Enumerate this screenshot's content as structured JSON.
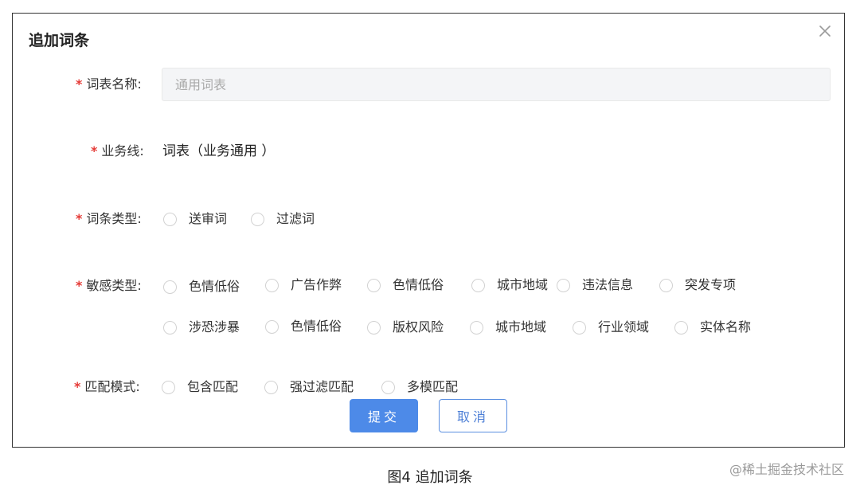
{
  "dialog": {
    "title": "追加词条",
    "close_icon": "close-x-icon"
  },
  "form": {
    "table_name": {
      "required_mark": "*",
      "label": "词表名称:",
      "placeholder": "通用词表",
      "value": ""
    },
    "business_line": {
      "required_mark": "*",
      "label": "业务线:",
      "value": "词表（业务通用 ）"
    },
    "entry_type": {
      "required_mark": "*",
      "label": "词条类型:",
      "options": [
        "送审词",
        "过滤词"
      ]
    },
    "sensitive_type": {
      "required_mark": "*",
      "label": "敏感类型:",
      "options": [
        "色情低俗",
        "广告作弊",
        "色情低俗",
        "城市地域",
        "违法信息",
        "突发专项",
        "涉恐涉暴",
        "色情低俗",
        "版权风险",
        "城市地域",
        "行业领域",
        "实体名称"
      ]
    },
    "match_mode": {
      "required_mark": "*",
      "label": "匹配模式:",
      "options": [
        "包含匹配",
        "强过滤匹配",
        "多模匹配"
      ]
    }
  },
  "actions": {
    "submit_label": "提交",
    "cancel_label": "取消"
  },
  "caption": "图4 追加词条",
  "watermark": "@稀土掘金技术社区",
  "colors": {
    "required": "#e53935",
    "primary": "#4d8ae8",
    "input_bg": "#f4f5f7"
  }
}
